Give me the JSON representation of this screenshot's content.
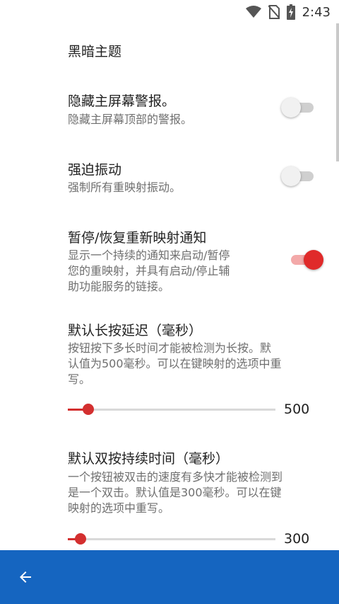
{
  "status_bar": {
    "time": "2:43",
    "icons": [
      "wifi-icon",
      "no-sim-icon",
      "battery-charging-icon"
    ]
  },
  "settings": {
    "dark_theme": {
      "title": "黑暗主题"
    },
    "hide_home_alerts": {
      "title": "隐藏主屏幕警报。",
      "description": "隐藏主屏幕顶部的警报。",
      "enabled": false
    },
    "force_vibration": {
      "title": "强迫振动",
      "description": "强制所有重映射振动。",
      "enabled": false
    },
    "pause_resume_notification": {
      "title": "暂停/恢复重新映射通知",
      "description_lines": [
        "显示一个持续的通知来启动/暂停",
        "您的重映射，并具有启动/停止辅",
        "助功能服务的链接。"
      ],
      "enabled": true
    },
    "long_press_delay": {
      "title": "默认长按延迟（毫秒）",
      "description_lines": [
        "按钮按下多长时间才能被检测为长按。默",
        "认值为500毫秒。可以在键映射的选项中重",
        "写。"
      ],
      "value": "500",
      "slider_fraction": 0.1
    },
    "double_press_duration": {
      "title": "默认双按持续时间（毫秒）",
      "description_lines": [
        "一个按钮被双击的速度有多快才能被检测到",
        "是一个双击。默认值是300毫秒。可以在键",
        "映射的选项中重写。"
      ],
      "value": "300",
      "slider_fraction": 0.06
    }
  },
  "colors": {
    "accent": "#d32f2f",
    "bottom_bar": "#1565c0"
  },
  "bottom_bar": {
    "back_icon": "arrow-back-icon"
  }
}
